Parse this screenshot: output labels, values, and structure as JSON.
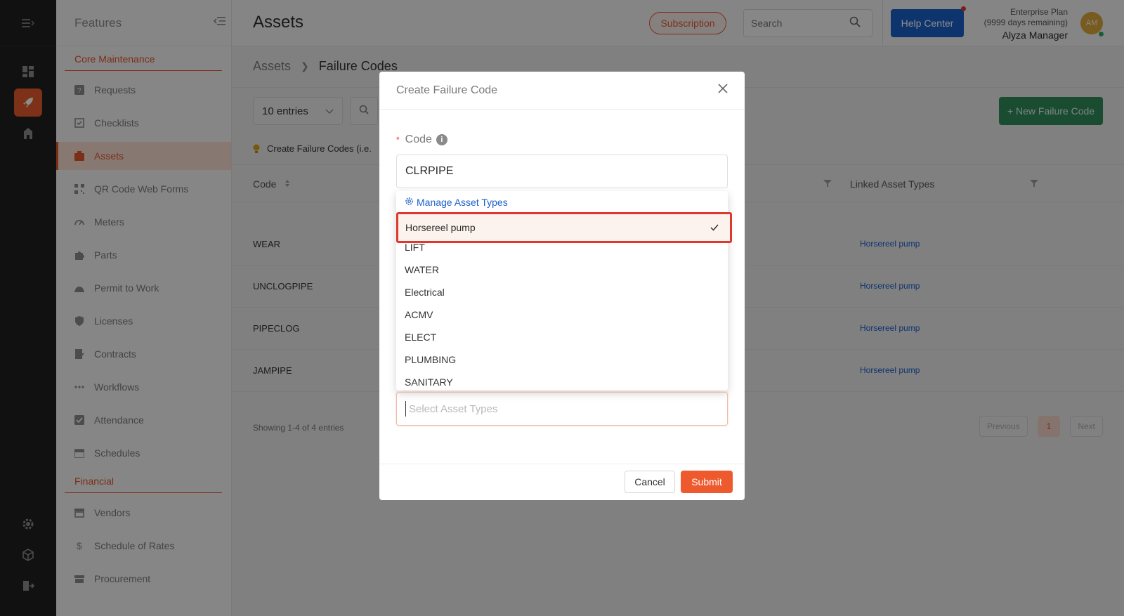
{
  "features": {
    "title": "Features",
    "sections": [
      {
        "label": "Core Maintenance"
      },
      {
        "label": "Financial"
      }
    ],
    "items": [
      {
        "label": "Requests",
        "icon": "question-square-icon"
      },
      {
        "label": "Checklists",
        "icon": "checklist-icon"
      },
      {
        "label": "Assets",
        "icon": "assets-icon"
      },
      {
        "label": "QR Code Web Forms",
        "icon": "qr-code-icon"
      },
      {
        "label": "Meters",
        "icon": "gauge-icon"
      },
      {
        "label": "Parts",
        "icon": "puzzle-icon"
      },
      {
        "label": "Permit to Work",
        "icon": "helmet-icon"
      },
      {
        "label": "Licenses",
        "icon": "shield-icon"
      },
      {
        "label": "Contracts",
        "icon": "contract-icon"
      },
      {
        "label": "Workflows",
        "icon": "dots-icon"
      },
      {
        "label": "Attendance",
        "icon": "check-square-icon"
      },
      {
        "label": "Schedules",
        "icon": "calendar-icon"
      },
      {
        "label": "Vendors",
        "icon": "store-icon"
      },
      {
        "label": "Schedule of Rates",
        "icon": "dollar-icon"
      },
      {
        "label": "Procurement",
        "icon": "cart-icon"
      }
    ]
  },
  "header": {
    "title": "Assets",
    "subscription_label": "Subscription",
    "search_placeholder": "Search",
    "help_label": "Help Center",
    "plan": "Enterprise Plan",
    "days": "(9999 days remaining)",
    "user_name": "Alyza Manager",
    "avatar_initials": "AM"
  },
  "content": {
    "breadcrumb": [
      "Assets",
      "Failure Codes"
    ],
    "entries_label": "10 entries",
    "new_button": "+ New Failure Code",
    "tip": "Create Failure Codes (i.e.",
    "columns": [
      "Code",
      "Linked Asset Types"
    ],
    "rows": [
      {
        "code": "WEAR",
        "linked": "Horsereel pump"
      },
      {
        "code": "UNCLOGPIPE",
        "linked": "Horsereel pump"
      },
      {
        "code": "PIPECLOG",
        "linked": "Horsereel pump"
      },
      {
        "code": "JAMPIPE",
        "linked": "Horsereel pump"
      }
    ],
    "showing": "Showing 1-4 of 4 entries",
    "pager": {
      "previous": "Previous",
      "page": "1",
      "next": "Next"
    }
  },
  "modal": {
    "title": "Create Failure Code",
    "code_label": "Code",
    "code_value": "CLRPIPE",
    "manage_label": "Manage Asset Types",
    "options": [
      "Horsereel pump",
      "LIFT",
      "WATER",
      "Electrical",
      "ACMV",
      "ELECT",
      "PLUMBING",
      "SANITARY"
    ],
    "selected": "Horsereel pump",
    "asset_placeholder": "Select Asset Types",
    "cancel_label": "Cancel",
    "submit_label": "Submit"
  },
  "colors": {
    "accent": "#e0562c",
    "primary": "#1a5fc8",
    "success": "#2f8a5a"
  }
}
